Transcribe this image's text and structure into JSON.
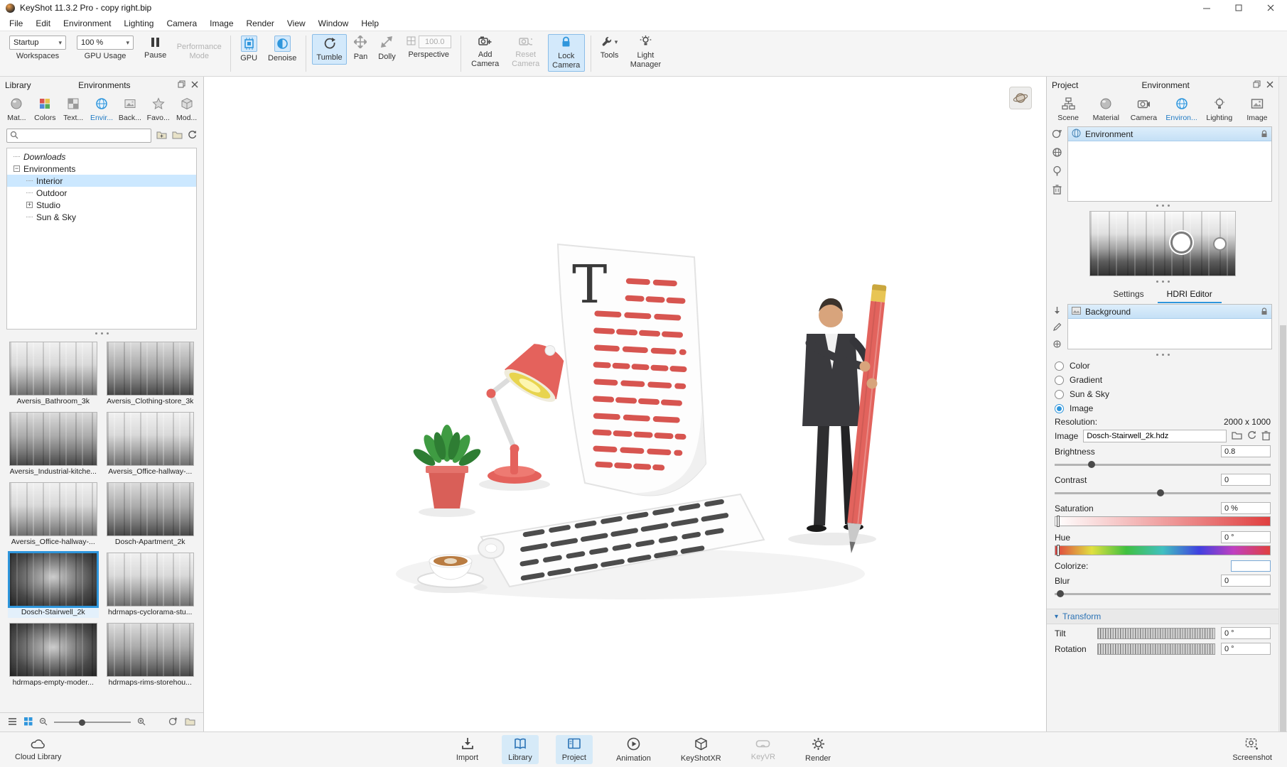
{
  "titlebar": {
    "title": "KeyShot 11.3.2 Pro  -  copy right.bip"
  },
  "menubar": {
    "items": [
      "File",
      "Edit",
      "Environment",
      "Lighting",
      "Camera",
      "Image",
      "Render",
      "View",
      "Window",
      "Help"
    ]
  },
  "toolbar": {
    "workspaces": {
      "value": "Startup",
      "label": "Workspaces"
    },
    "gpu_usage": {
      "value": "100 %",
      "label": "GPU Usage"
    },
    "pause_label": "Pause",
    "performance_mode_label": "Performance Mode",
    "gpu_label": "GPU",
    "denoise_label": "Denoise",
    "tumble_label": "Tumble",
    "pan_label": "Pan",
    "dolly_label": "Dolly",
    "perspective": {
      "value": "100.0",
      "label": "Perspective"
    },
    "add_camera_label": "Add Camera",
    "reset_camera_label": "Reset Camera",
    "lock_camera_label": "Lock Camera",
    "tools_label": "Tools",
    "light_manager_label": "Light Manager"
  },
  "library": {
    "header_title": "Library",
    "panel_title": "Environments",
    "tabs": [
      {
        "label": "Mat..."
      },
      {
        "label": "Colors"
      },
      {
        "label": "Text..."
      },
      {
        "label": "Envir..."
      },
      {
        "label": "Back..."
      },
      {
        "label": "Favo..."
      },
      {
        "label": "Mod..."
      }
    ],
    "tree": [
      {
        "label": "Downloads"
      },
      {
        "label": "Environments"
      },
      {
        "label": "Interior"
      },
      {
        "label": "Outdoor"
      },
      {
        "label": "Studio"
      },
      {
        "label": "Sun & Sky"
      }
    ],
    "thumbnails": [
      {
        "name": "Aversis_Bathroom_3k"
      },
      {
        "name": "Aversis_Clothing-store_3k"
      },
      {
        "name": "Aversis_Industrial-kitche..."
      },
      {
        "name": "Aversis_Office-hallway-..."
      },
      {
        "name": "Aversis_Office-hallway-..."
      },
      {
        "name": "Dosch-Apartment_2k"
      },
      {
        "name": "Dosch-Stairwell_2k"
      },
      {
        "name": "hdrmaps-cyclorama-stu..."
      },
      {
        "name": "hdrmaps-empty-moder..."
      },
      {
        "name": "hdrmaps-rims-storehou..."
      }
    ]
  },
  "scene": {
    "letter": "T"
  },
  "project": {
    "header_title": "Project",
    "panel_title": "Environment",
    "tabs": [
      {
        "label": "Scene"
      },
      {
        "label": "Material"
      },
      {
        "label": "Camera"
      },
      {
        "label": "Environ..."
      },
      {
        "label": "Lighting"
      },
      {
        "label": "Image"
      }
    ],
    "environment_item": "Environment",
    "sub_tabs": [
      {
        "label": "Settings"
      },
      {
        "label": "HDRI Editor"
      }
    ],
    "background_item": "Background",
    "type_options": [
      {
        "label": "Color"
      },
      {
        "label": "Gradient"
      },
      {
        "label": "Sun & Sky"
      },
      {
        "label": "Image"
      }
    ],
    "resolution_label": "Resolution:",
    "resolution_value": "2000 x 1000",
    "image_label": "Image",
    "image_value": "Dosch-Stairwell_2k.hdz",
    "brightness": {
      "label": "Brightness",
      "value": "0.8"
    },
    "contrast": {
      "label": "Contrast",
      "value": "0"
    },
    "saturation": {
      "label": "Saturation",
      "value": "0 %"
    },
    "hue": {
      "label": "Hue",
      "value": "0 °"
    },
    "colorize_label": "Colorize:",
    "blur": {
      "label": "Blur",
      "value": "0"
    },
    "transform": {
      "title": "Transform",
      "tilt": {
        "label": "Tilt",
        "value": "0 °"
      },
      "rotation": {
        "label": "Rotation",
        "value": "0 °"
      }
    }
  },
  "bottombar": {
    "cloud_library": "Cloud Library",
    "items": [
      {
        "label": "Import"
      },
      {
        "label": "Library"
      },
      {
        "label": "Project"
      },
      {
        "label": "Animation"
      },
      {
        "label": "KeyShotXR"
      },
      {
        "label": "KeyVR"
      },
      {
        "label": "Render"
      }
    ],
    "screenshot": "Screenshot"
  }
}
